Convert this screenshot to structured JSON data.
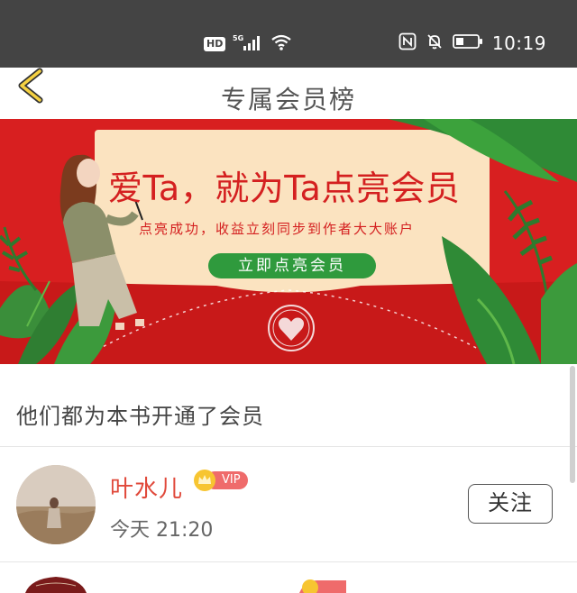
{
  "status_bar": {
    "hd": "HD",
    "network": "5G",
    "time": "10:19"
  },
  "header": {
    "title": "专属会员榜"
  },
  "banner": {
    "headline": "爱Ta，就为Ta点亮会员",
    "subtitle": "点亮成功，收益立刻同步到作者大大账户",
    "button": "立即点亮会员"
  },
  "section": {
    "title": "他们都为本书开通了会员"
  },
  "members": [
    {
      "name": "叶水儿",
      "badge": "VIP",
      "time": "今天 21:20",
      "action": "关注"
    }
  ],
  "colors": {
    "status_bar": "#444444",
    "banner_red": "#d81f20",
    "accent_green": "#2f9a3d",
    "name_red": "#e0493b",
    "vip_pink": "#ef6b6b"
  }
}
